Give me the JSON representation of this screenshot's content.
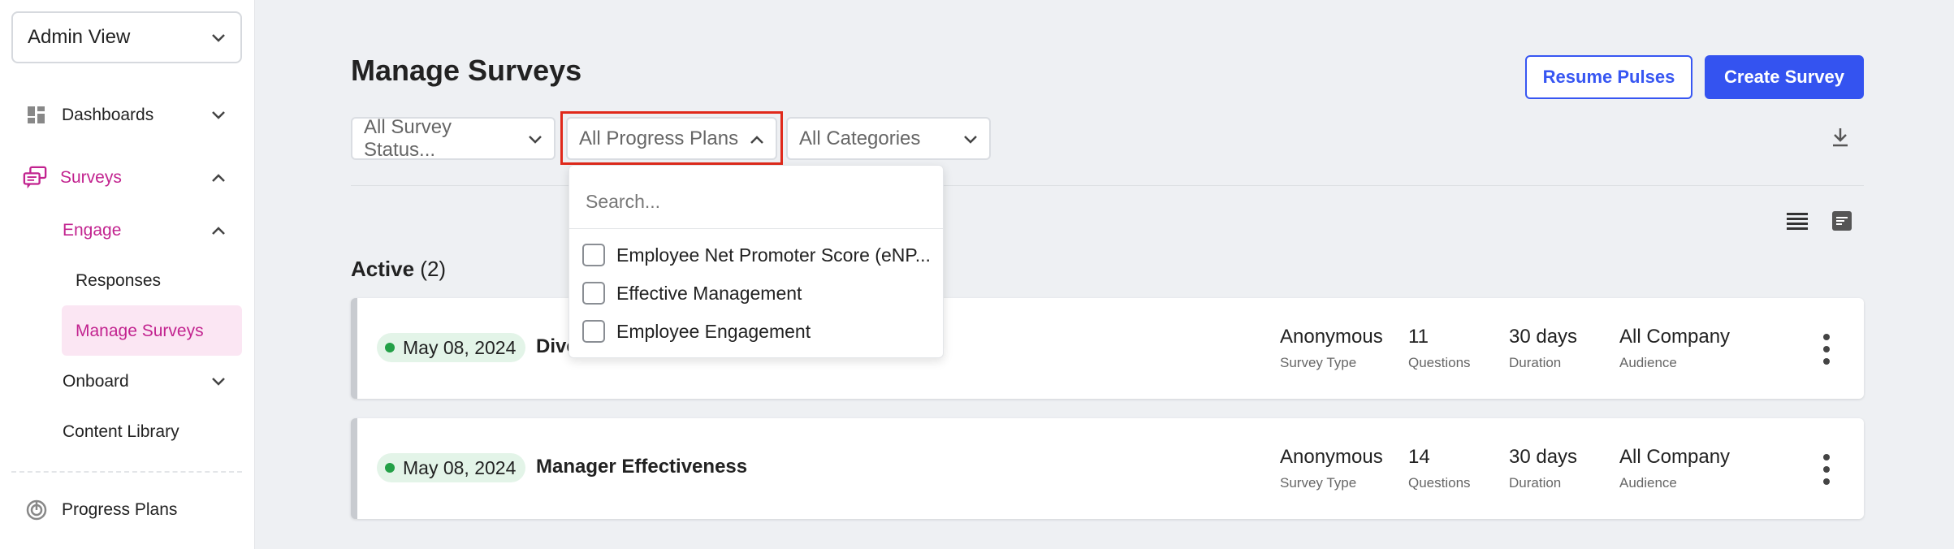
{
  "sidebar": {
    "view_select": "Admin View",
    "items": [
      {
        "label": "Dashboards"
      },
      {
        "label": "Surveys"
      },
      {
        "label": "Engage"
      },
      {
        "label": "Responses"
      },
      {
        "label": "Manage Surveys"
      },
      {
        "label": "Onboard"
      },
      {
        "label": "Content Library"
      },
      {
        "label": "Progress Plans"
      }
    ]
  },
  "header": {
    "title": "Manage Surveys",
    "resume_label": "Resume Pulses",
    "create_label": "Create Survey"
  },
  "filters": {
    "status": "All Survey Status...",
    "plans": "All Progress Plans",
    "categories": "All Categories"
  },
  "dropdown": {
    "search_placeholder": "Search...",
    "options": [
      "Employee Net Promoter Score (eNP...",
      "Effective Management",
      "Employee Engagement"
    ]
  },
  "section": {
    "title": "Active",
    "count": "(2)"
  },
  "surveys": [
    {
      "date": "May 08, 2024",
      "name": "Dive",
      "type_value": "Anonymous",
      "type_label": "Survey Type",
      "questions_value": "11",
      "questions_label": "Questions",
      "duration_value": "30 days",
      "duration_label": "Duration",
      "audience_value": "All Company",
      "audience_label": "Audience"
    },
    {
      "date": "May 08, 2024",
      "name": "Manager Effectiveness",
      "type_value": "Anonymous",
      "type_label": "Survey Type",
      "questions_value": "14",
      "questions_label": "Questions",
      "duration_value": "30 days",
      "duration_label": "Duration",
      "audience_value": "All Company",
      "audience_label": "Audience"
    }
  ],
  "colors": {
    "accent": "#3453f0",
    "brand_pink": "#c2238f",
    "active_dot": "#23a047",
    "highlight": "#e0291b"
  }
}
